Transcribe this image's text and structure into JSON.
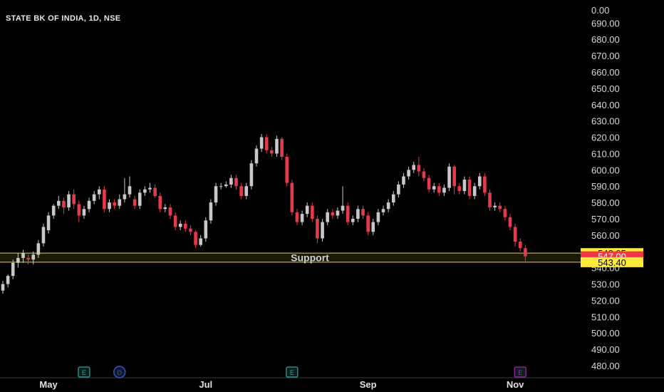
{
  "chart_data": {
    "type": "candlestick",
    "title": "STATE BK OF INDIA, 1D, NSE",
    "ylim": [
      475,
      700
    ],
    "y_ticks": [
      "0.00",
      "690.00",
      "680.00",
      "670.00",
      "660.00",
      "650.00",
      "640.00",
      "630.00",
      "620.00",
      "610.00",
      "600.00",
      "590.00",
      "580.00",
      "570.00",
      "560.00",
      "550.00",
      "540.00",
      "530.00",
      "520.00",
      "510.00",
      "500.00",
      "490.00",
      "480.00"
    ],
    "x_ticks": [
      {
        "label": "May",
        "index": 9
      },
      {
        "label": "Jul",
        "index": 40
      },
      {
        "label": "Sep",
        "index": 72
      },
      {
        "label": "Nov",
        "index": 101
      }
    ],
    "events": [
      {
        "label": "E",
        "index": 16,
        "color": "#26a69a"
      },
      {
        "label": "D",
        "index": 23,
        "color": "#3f51b5"
      },
      {
        "label": "E",
        "index": 57,
        "color": "#26a69a"
      },
      {
        "label": "E",
        "index": 102,
        "color": "#9c27b0"
      }
    ],
    "support_zone": {
      "label": "Support",
      "upper": 548.95,
      "lower": 543.4
    },
    "price_labels": [
      {
        "text": "548.95",
        "value": 548.95,
        "bg": "#ffeb3b",
        "fg": "#000000"
      },
      {
        "text": "547.00",
        "value": 547.0,
        "bg": "#f23645",
        "fg": "#ffffff"
      },
      {
        "text": "543.40",
        "value": 543.4,
        "bg": "#ffeb3b",
        "fg": "#000000"
      }
    ],
    "colors": {
      "up": "#c8c8c8",
      "down": "#e53a4a",
      "grid": "#2a2a2a",
      "support_line": "#e6d03a"
    },
    "candles": [
      [
        526,
        530,
        532,
        524
      ],
      [
        530,
        535,
        536,
        528
      ],
      [
        535,
        543,
        545,
        533
      ],
      [
        543,
        546,
        549,
        540
      ],
      [
        546,
        549,
        551,
        543
      ],
      [
        546,
        545,
        548,
        542
      ],
      [
        545,
        548,
        550,
        542
      ],
      [
        548,
        555,
        557,
        546
      ],
      [
        555,
        565,
        567,
        553
      ],
      [
        563,
        572,
        574,
        561
      ],
      [
        572,
        578,
        579,
        570
      ],
      [
        578,
        581,
        584,
        576
      ],
      [
        581,
        577,
        583,
        573
      ],
      [
        577,
        585,
        587,
        575
      ],
      [
        585,
        579,
        588,
        576
      ],
      [
        579,
        572,
        581,
        568
      ],
      [
        572,
        576,
        578,
        570
      ],
      [
        576,
        581,
        583,
        574
      ],
      [
        581,
        585,
        587,
        579
      ],
      [
        585,
        588,
        590,
        582
      ],
      [
        588,
        576,
        590,
        574
      ],
      [
        576,
        580,
        582,
        574
      ],
      [
        580,
        578,
        582,
        576
      ],
      [
        578,
        582,
        585,
        576
      ],
      [
        582,
        585,
        595,
        580
      ],
      [
        585,
        590,
        596,
        583
      ],
      [
        582,
        578,
        584,
        576
      ],
      [
        578,
        586,
        588,
        576
      ],
      [
        586,
        588,
        590,
        584
      ],
      [
        588,
        589,
        592,
        586
      ],
      [
        589,
        584,
        591,
        583
      ],
      [
        584,
        576,
        586,
        574
      ],
      [
        576,
        577,
        579,
        574
      ],
      [
        577,
        572,
        579,
        570
      ],
      [
        572,
        565,
        574,
        563
      ],
      [
        565,
        567,
        569,
        563
      ],
      [
        567,
        564,
        569,
        562
      ],
      [
        564,
        562,
        566,
        560
      ],
      [
        562,
        554,
        563,
        552
      ],
      [
        554,
        558,
        560,
        553
      ],
      [
        558,
        569,
        571,
        556
      ],
      [
        569,
        580,
        582,
        567
      ],
      [
        580,
        590,
        592,
        578
      ],
      [
        590,
        590,
        592,
        588
      ],
      [
        590,
        591,
        593,
        589
      ],
      [
        591,
        595,
        597,
        589
      ],
      [
        595,
        590,
        597,
        588
      ],
      [
        590,
        584,
        592,
        582
      ],
      [
        584,
        590,
        592,
        582
      ],
      [
        590,
        604,
        606,
        588
      ],
      [
        604,
        613,
        615,
        602
      ],
      [
        613,
        620,
        622,
        611
      ],
      [
        620,
        612,
        622,
        610
      ],
      [
        612,
        610,
        614,
        608
      ],
      [
        610,
        619,
        621,
        608
      ],
      [
        619,
        608,
        620,
        606
      ],
      [
        608,
        592,
        610,
        590
      ],
      [
        592,
        574,
        594,
        572
      ],
      [
        574,
        568,
        576,
        566
      ],
      [
        568,
        573,
        575,
        566
      ],
      [
        573,
        578,
        580,
        571
      ],
      [
        578,
        570,
        580,
        568
      ],
      [
        570,
        558,
        572,
        555
      ],
      [
        558,
        568,
        570,
        556
      ],
      [
        568,
        574,
        576,
        566
      ],
      [
        574,
        572,
        576,
        570
      ],
      [
        572,
        575,
        577,
        570
      ],
      [
        575,
        578,
        590,
        573
      ],
      [
        578,
        568,
        580,
        566
      ],
      [
        568,
        570,
        572,
        566
      ],
      [
        570,
        576,
        578,
        568
      ],
      [
        576,
        572,
        578,
        570
      ],
      [
        572,
        562,
        574,
        560
      ],
      [
        562,
        568,
        570,
        560
      ],
      [
        568,
        574,
        576,
        566
      ],
      [
        574,
        576,
        578,
        572
      ],
      [
        576,
        580,
        582,
        574
      ],
      [
        580,
        585,
        587,
        578
      ],
      [
        585,
        591,
        593,
        583
      ],
      [
        591,
        596,
        598,
        589
      ],
      [
        596,
        600,
        602,
        594
      ],
      [
        600,
        603,
        605,
        598
      ],
      [
        603,
        599,
        608,
        596
      ],
      [
        599,
        595,
        601,
        593
      ],
      [
        595,
        588,
        597,
        586
      ],
      [
        588,
        590,
        592,
        586
      ],
      [
        590,
        586,
        592,
        584
      ],
      [
        586,
        589,
        591,
        584
      ],
      [
        589,
        602,
        604,
        587
      ],
      [
        602,
        590,
        603,
        585
      ],
      [
        590,
        587,
        592,
        585
      ],
      [
        587,
        594,
        596,
        585
      ],
      [
        594,
        584,
        596,
        582
      ],
      [
        584,
        590,
        592,
        582
      ],
      [
        590,
        596,
        598,
        588
      ],
      [
        596,
        586,
        598,
        584
      ],
      [
        586,
        577,
        588,
        575
      ],
      [
        577,
        578,
        580,
        575
      ],
      [
        578,
        576,
        580,
        574
      ],
      [
        576,
        571,
        578,
        569
      ],
      [
        571,
        565,
        573,
        563
      ],
      [
        565,
        556,
        567,
        553
      ],
      [
        556,
        552,
        558,
        550
      ],
      [
        552,
        547,
        554,
        544
      ]
    ]
  }
}
